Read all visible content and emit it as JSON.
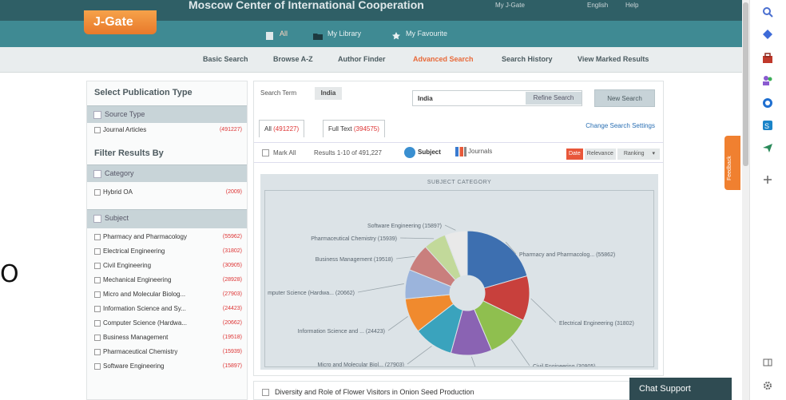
{
  "header": {
    "institution": "Moscow Center of International Cooperation",
    "mini_links": [
      "My J-Gate",
      "English",
      "Help"
    ],
    "logo": "J-Gate"
  },
  "nav": {
    "tabs": [
      {
        "label": "All",
        "icon": "page-icon"
      },
      {
        "label": "My Library",
        "icon": "folder-icon"
      },
      {
        "label": "My Favourite",
        "icon": "star-icon"
      }
    ]
  },
  "menu": {
    "items": [
      "Basic Search",
      "Browse A-Z",
      "Author Finder",
      "Advanced Search",
      "Search History",
      "View Marked Results"
    ],
    "selected": "Advanced Search"
  },
  "left": {
    "pub_type_title": "Select Publication Type",
    "source_type": "Source Type",
    "journal_articles": {
      "label": "Journal Articles",
      "count": "(491227)"
    },
    "filter_title": "Filter Results By",
    "category": "Category",
    "hybrid_oa": {
      "label": "Hybrid OA",
      "count": "(2009)"
    },
    "subject": "Subject",
    "subjects": [
      {
        "label": "Pharmacy and Pharmacology",
        "count": "(55962)"
      },
      {
        "label": "Electrical Engineering",
        "count": "(31802)"
      },
      {
        "label": "Civil Engineering",
        "count": "(30905)"
      },
      {
        "label": "Mechanical Engineering",
        "count": "(28928)"
      },
      {
        "label": "Micro and Molecular Biolog...",
        "count": "(27903)"
      },
      {
        "label": "Information Science and Sy...",
        "count": "(24423)"
      },
      {
        "label": "Computer Science (Hardwa...",
        "count": "(20662)"
      },
      {
        "label": "Business Management",
        "count": "(19518)"
      },
      {
        "label": "Pharmaceutical Chemistry",
        "count": "(15939)"
      },
      {
        "label": "Software Engineering",
        "count": "(15897)"
      }
    ]
  },
  "search": {
    "term_label": "Search Term",
    "term_tag": "India",
    "input_value": "India",
    "refine_label": "Refine Search",
    "new_search_label": "New Search",
    "tab_all": "All",
    "tab_all_count": "(491227)",
    "tab_fulltext": "Full Text",
    "tab_fulltext_count": "(394575)",
    "change_settings": "Change Search Settings",
    "mark_all": "Mark All",
    "results_text": "Results 1-10 of 491,227",
    "subject_btn": "Subject",
    "journals_btn": "Journals",
    "sort_date": "Date",
    "sort_relevance": "Relevance",
    "sort_ranking": "Ranking"
  },
  "chart_data": {
    "type": "pie",
    "title": "SUBJECT CATEGORY",
    "categories": [
      "Pharmacy and Pharmacolog... (55862)",
      "Electrical Engineering (31802)",
      "Civil Engineering (30905)",
      "Mechanical Engineering (28928)",
      "Micro and Molecular Biol... (27903)",
      "Information Science and ... (24423)",
      "mputer Science (Hardwa... (20662)",
      "Business Management (19518)",
      "Pharmaceutical Chemistry (15939)",
      "Software Engineering (15897)"
    ],
    "values": [
      55862,
      31802,
      30905,
      28928,
      27903,
      24423,
      20662,
      19518,
      15939,
      15897
    ],
    "colors": [
      "#3d6fb0",
      "#c8403c",
      "#8fbf4f",
      "#8a63b3",
      "#3aa3bd",
      "#f08a2e",
      "#9bb4dc",
      "#c97f7d",
      "#c2d99a",
      "#e9e9e9"
    ]
  },
  "result": {
    "title": "Diversity and Role of Flower Visitors in Onion Seed Production"
  },
  "chat_label": "Chat Support",
  "feedback_label": "Feedback",
  "bigO": "O",
  "sidebar_icons": [
    "search-icon",
    "diamond-icon",
    "toolbox-icon",
    "people-icon",
    "outlook-icon",
    "teams-icon",
    "plane-icon",
    "plus-icon",
    "panel-icon",
    "settings-icon"
  ]
}
